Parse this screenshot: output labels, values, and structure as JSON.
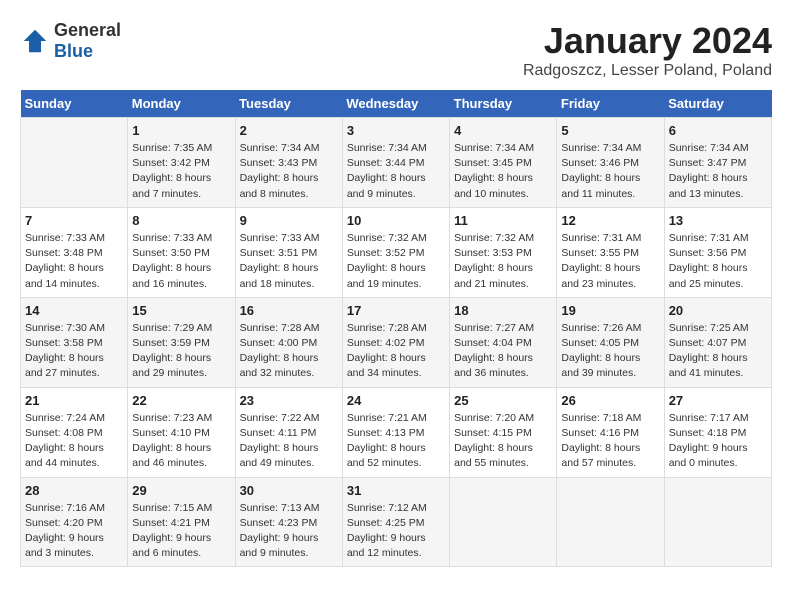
{
  "logo": {
    "general": "General",
    "blue": "Blue"
  },
  "title": "January 2024",
  "subtitle": "Radgoszcz, Lesser Poland, Poland",
  "days_of_week": [
    "Sunday",
    "Monday",
    "Tuesday",
    "Wednesday",
    "Thursday",
    "Friday",
    "Saturday"
  ],
  "weeks": [
    [
      {
        "day": "",
        "info": ""
      },
      {
        "day": "1",
        "info": "Sunrise: 7:35 AM\nSunset: 3:42 PM\nDaylight: 8 hours\nand 7 minutes."
      },
      {
        "day": "2",
        "info": "Sunrise: 7:34 AM\nSunset: 3:43 PM\nDaylight: 8 hours\nand 8 minutes."
      },
      {
        "day": "3",
        "info": "Sunrise: 7:34 AM\nSunset: 3:44 PM\nDaylight: 8 hours\nand 9 minutes."
      },
      {
        "day": "4",
        "info": "Sunrise: 7:34 AM\nSunset: 3:45 PM\nDaylight: 8 hours\nand 10 minutes."
      },
      {
        "day": "5",
        "info": "Sunrise: 7:34 AM\nSunset: 3:46 PM\nDaylight: 8 hours\nand 11 minutes."
      },
      {
        "day": "6",
        "info": "Sunrise: 7:34 AM\nSunset: 3:47 PM\nDaylight: 8 hours\nand 13 minutes."
      }
    ],
    [
      {
        "day": "7",
        "info": "Sunrise: 7:33 AM\nSunset: 3:48 PM\nDaylight: 8 hours\nand 14 minutes."
      },
      {
        "day": "8",
        "info": "Sunrise: 7:33 AM\nSunset: 3:50 PM\nDaylight: 8 hours\nand 16 minutes."
      },
      {
        "day": "9",
        "info": "Sunrise: 7:33 AM\nSunset: 3:51 PM\nDaylight: 8 hours\nand 18 minutes."
      },
      {
        "day": "10",
        "info": "Sunrise: 7:32 AM\nSunset: 3:52 PM\nDaylight: 8 hours\nand 19 minutes."
      },
      {
        "day": "11",
        "info": "Sunrise: 7:32 AM\nSunset: 3:53 PM\nDaylight: 8 hours\nand 21 minutes."
      },
      {
        "day": "12",
        "info": "Sunrise: 7:31 AM\nSunset: 3:55 PM\nDaylight: 8 hours\nand 23 minutes."
      },
      {
        "day": "13",
        "info": "Sunrise: 7:31 AM\nSunset: 3:56 PM\nDaylight: 8 hours\nand 25 minutes."
      }
    ],
    [
      {
        "day": "14",
        "info": "Sunrise: 7:30 AM\nSunset: 3:58 PM\nDaylight: 8 hours\nand 27 minutes."
      },
      {
        "day": "15",
        "info": "Sunrise: 7:29 AM\nSunset: 3:59 PM\nDaylight: 8 hours\nand 29 minutes."
      },
      {
        "day": "16",
        "info": "Sunrise: 7:28 AM\nSunset: 4:00 PM\nDaylight: 8 hours\nand 32 minutes."
      },
      {
        "day": "17",
        "info": "Sunrise: 7:28 AM\nSunset: 4:02 PM\nDaylight: 8 hours\nand 34 minutes."
      },
      {
        "day": "18",
        "info": "Sunrise: 7:27 AM\nSunset: 4:04 PM\nDaylight: 8 hours\nand 36 minutes."
      },
      {
        "day": "19",
        "info": "Sunrise: 7:26 AM\nSunset: 4:05 PM\nDaylight: 8 hours\nand 39 minutes."
      },
      {
        "day": "20",
        "info": "Sunrise: 7:25 AM\nSunset: 4:07 PM\nDaylight: 8 hours\nand 41 minutes."
      }
    ],
    [
      {
        "day": "21",
        "info": "Sunrise: 7:24 AM\nSunset: 4:08 PM\nDaylight: 8 hours\nand 44 minutes."
      },
      {
        "day": "22",
        "info": "Sunrise: 7:23 AM\nSunset: 4:10 PM\nDaylight: 8 hours\nand 46 minutes."
      },
      {
        "day": "23",
        "info": "Sunrise: 7:22 AM\nSunset: 4:11 PM\nDaylight: 8 hours\nand 49 minutes."
      },
      {
        "day": "24",
        "info": "Sunrise: 7:21 AM\nSunset: 4:13 PM\nDaylight: 8 hours\nand 52 minutes."
      },
      {
        "day": "25",
        "info": "Sunrise: 7:20 AM\nSunset: 4:15 PM\nDaylight: 8 hours\nand 55 minutes."
      },
      {
        "day": "26",
        "info": "Sunrise: 7:18 AM\nSunset: 4:16 PM\nDaylight: 8 hours\nand 57 minutes."
      },
      {
        "day": "27",
        "info": "Sunrise: 7:17 AM\nSunset: 4:18 PM\nDaylight: 9 hours\nand 0 minutes."
      }
    ],
    [
      {
        "day": "28",
        "info": "Sunrise: 7:16 AM\nSunset: 4:20 PM\nDaylight: 9 hours\nand 3 minutes."
      },
      {
        "day": "29",
        "info": "Sunrise: 7:15 AM\nSunset: 4:21 PM\nDaylight: 9 hours\nand 6 minutes."
      },
      {
        "day": "30",
        "info": "Sunrise: 7:13 AM\nSunset: 4:23 PM\nDaylight: 9 hours\nand 9 minutes."
      },
      {
        "day": "31",
        "info": "Sunrise: 7:12 AM\nSunset: 4:25 PM\nDaylight: 9 hours\nand 12 minutes."
      },
      {
        "day": "",
        "info": ""
      },
      {
        "day": "",
        "info": ""
      },
      {
        "day": "",
        "info": ""
      }
    ]
  ]
}
